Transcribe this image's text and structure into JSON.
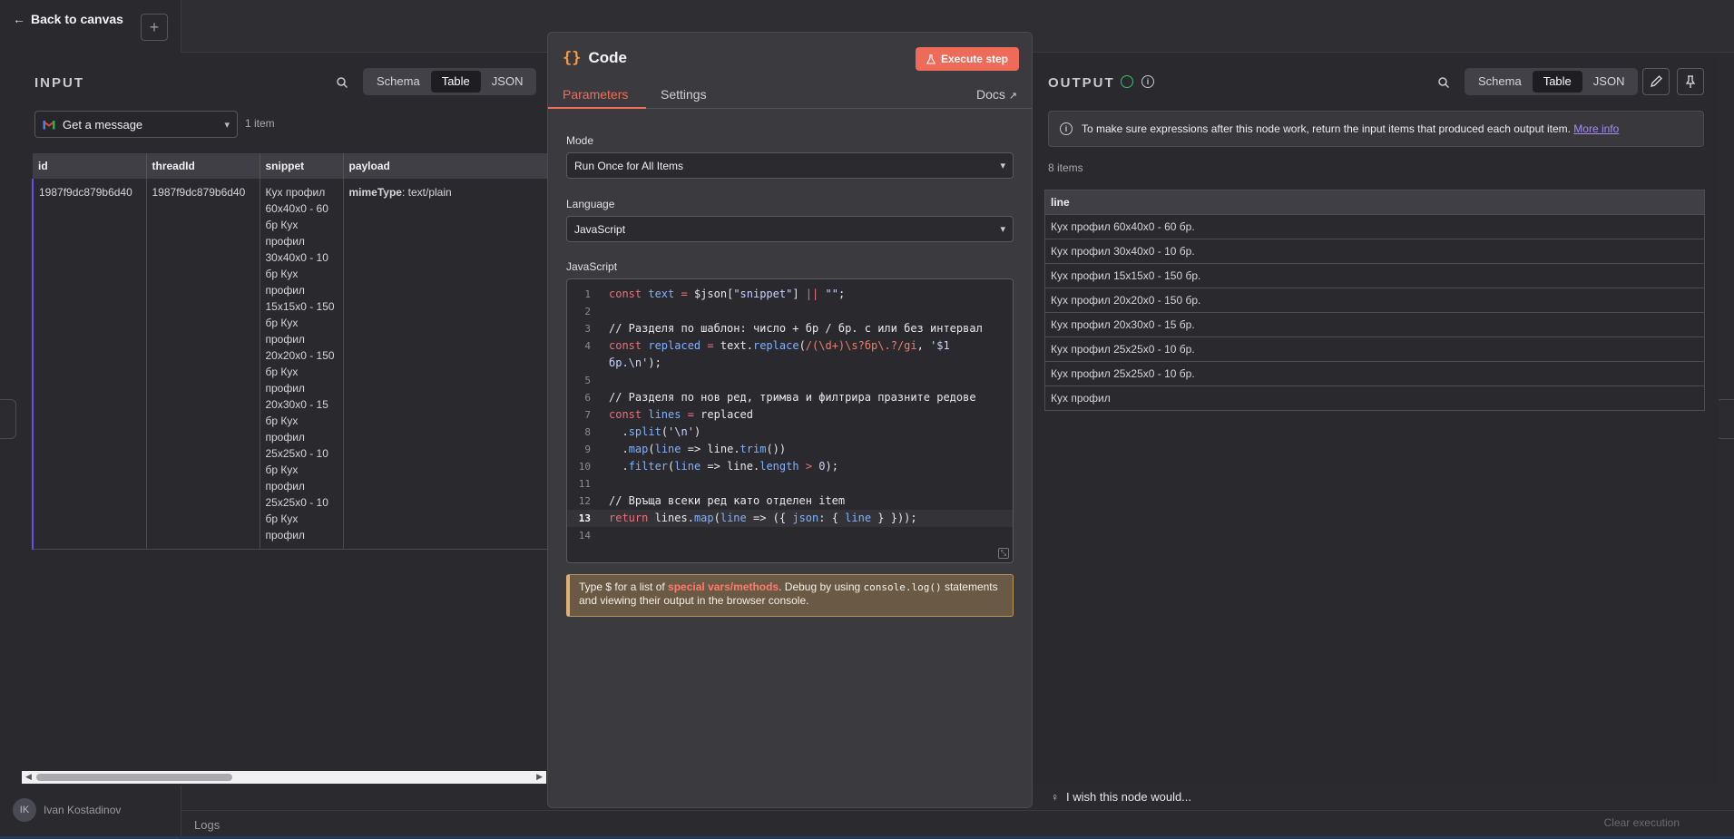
{
  "app": {
    "back_label": "Back to canvas",
    "plus": "+",
    "user_initials": "IK",
    "user_name": "Ivan Kostadinov",
    "logs_label": "Logs",
    "clear_execution": "Clear execution"
  },
  "input": {
    "title": "INPUT",
    "view_modes": [
      "Schema",
      "Table",
      "JSON"
    ],
    "active_view": "Table",
    "node_select": "Get a message",
    "item_count": "1 item",
    "columns": [
      "id",
      "threadId",
      "snippet",
      "payload"
    ],
    "row": {
      "id": "1987f9dc879b6d40",
      "threadId": "1987f9dc879b6d40",
      "snippet": "Кух профил 60x40x0 - 60 бр Кух профил 30x40x0 - 10 бр Кух профил 15x15x0 - 150 бр Кух профил 20x20x0 - 150 бр Кух профил 20x30x0 - 15 бр Кух профил 25x25x0 - 10 бр Кух профил 25x25x0 - 10 бр Кух профил",
      "payload_key": "mimeType",
      "payload_value": ": text/plain"
    }
  },
  "code": {
    "title": "Code",
    "execute_label": "Execute step",
    "tabs": {
      "parameters": "Parameters",
      "settings": "Settings",
      "docs": "Docs"
    },
    "mode_label": "Mode",
    "mode_value": "Run Once for All Items",
    "language_label": "Language",
    "language_value": "JavaScript",
    "editor_label": "JavaScript",
    "line_numbers": [
      "1",
      "2",
      "3",
      "4",
      "",
      "5",
      "6",
      "7",
      "8",
      "9",
      "10",
      "11",
      "12",
      "13",
      "14"
    ],
    "current_line": "13",
    "tip": {
      "prefix": "Type $ for a list of ",
      "link": "special vars/methods",
      "middle": ". Debug by using ",
      "code": "console.log()",
      "suffix": " statements and viewing their output in the browser console."
    }
  },
  "output": {
    "title": "OUTPUT",
    "view_modes": [
      "Schema",
      "Table",
      "JSON"
    ],
    "active_view": "Table",
    "banner_text": "To make sure expressions after this node work, return the input items that produced each output item.",
    "banner_link": "More info",
    "item_count": "8 items",
    "column": "line",
    "rows": [
      "Кух профил 60x40x0 - 60 бр.",
      "Кух профил 30x40x0 - 10 бр.",
      "Кух профил 15x15x0 - 150 бр.",
      "Кух профил 20x20x0 - 150 бр.",
      "Кух профил 20x30x0 - 15 бр.",
      "Кух профил 25x25x0 - 10 бр.",
      "Кух профил 25x25x0 - 10 бр.",
      "Кух профил"
    ],
    "wish_text": "I wish this node would..."
  },
  "colors": {
    "accent": "#ef6d5b",
    "execute": "#ee6b5a",
    "link_purple": "#a48cf2",
    "success": "#3bbf6b"
  },
  "icons": [
    "search-icon",
    "gmail-icon",
    "chevron-down-icon",
    "flask-icon",
    "external-link-icon",
    "info-icon",
    "check-circle-icon",
    "pencil-icon",
    "pin-icon",
    "lightbulb-icon"
  ]
}
